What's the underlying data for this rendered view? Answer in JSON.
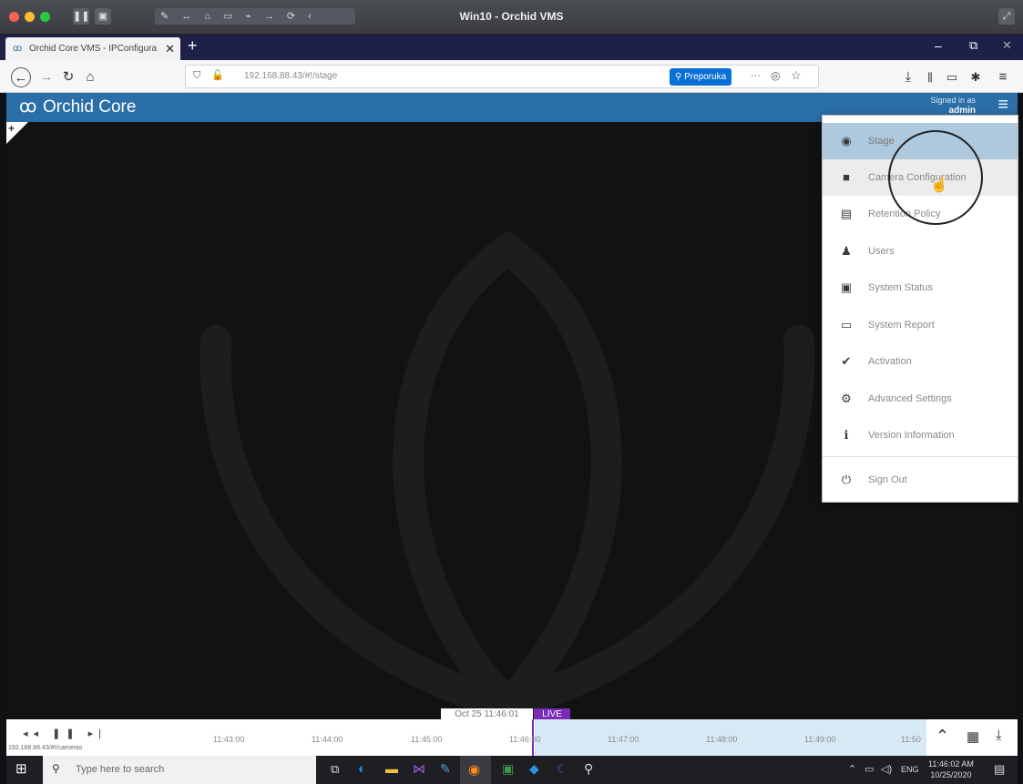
{
  "mac": {
    "title": "Win10 - Orchid VMS"
  },
  "browser": {
    "tab_title": "Orchid Core VMS - IPConfigura",
    "url": "192.168.88.43/#!/stage",
    "preporuka": "Preporuka"
  },
  "app": {
    "brand": "Orchid Core",
    "signed_in_label": "Signed in as",
    "signed_in_user": "admin"
  },
  "menu": {
    "items": [
      {
        "label": "Stage",
        "icon": "eye-icon",
        "glyph": "◉"
      },
      {
        "label": "Camera Configuration",
        "icon": "video-camera-icon",
        "glyph": "■"
      },
      {
        "label": "Retention Policy",
        "icon": "database-icon",
        "glyph": "▤"
      },
      {
        "label": "Users",
        "icon": "user-icon",
        "glyph": "♟"
      },
      {
        "label": "System Status",
        "icon": "medkit-icon",
        "glyph": "▣"
      },
      {
        "label": "System Report",
        "icon": "report-icon",
        "glyph": "▭"
      },
      {
        "label": "Activation",
        "icon": "plug-icon",
        "glyph": "✔"
      },
      {
        "label": "Advanced Settings",
        "icon": "cogs-icon",
        "glyph": "⚙"
      },
      {
        "label": "Version Information",
        "icon": "info-icon",
        "glyph": "ℹ"
      },
      {
        "label": "Sign Out",
        "icon": "power-icon",
        "glyph": "⏻"
      }
    ]
  },
  "timeline": {
    "current": "Oct 25 11:46:01",
    "live": "LIVE",
    "status_url": "192.168.88.43/#!/cameras",
    "ticks": [
      "11:43:00",
      "11:44:00",
      "11:45:00",
      "11:46:00",
      "11:47:00",
      "11:48:00",
      "11:49:00",
      "11:50"
    ]
  },
  "taskbar": {
    "search_placeholder": "Type here to search",
    "lang": "ENG",
    "time": "11:46:02 AM",
    "date": "10/25/2020"
  }
}
